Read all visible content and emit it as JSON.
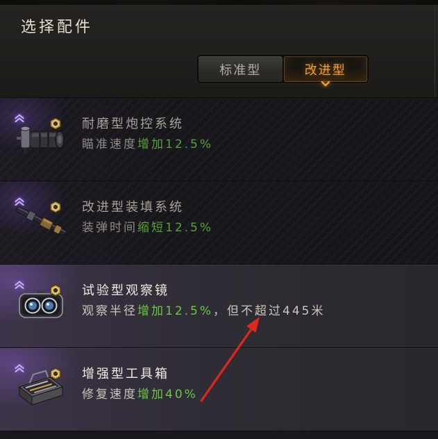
{
  "panel": {
    "title": "选择配件"
  },
  "tabs": [
    {
      "label": "标准型",
      "selected": false
    },
    {
      "label": "改进型",
      "selected": true
    }
  ],
  "equipment_list": [
    {
      "name": "耐磨型炮控系统",
      "stat": "瞄准速度",
      "change": "增加12.5%",
      "icon": "gun-laying-drive-icon",
      "dimmed": true
    },
    {
      "name": "改进型装填系统",
      "stat": "装弹时间",
      "change": "缩短12.5%",
      "icon": "rammer-icon",
      "dimmed": true
    },
    {
      "name": "试验型观察镜",
      "stat": "观察半径",
      "change": "增加12.5%",
      "limit": "，但不超过445米",
      "icon": "optics-icon",
      "dimmed": false
    },
    {
      "name": "增强型工具箱",
      "stat": "修复速度",
      "change": "增加40%",
      "icon": "toolbox-icon",
      "dimmed": false
    }
  ],
  "icons": {
    "upgrade": "upgrade-chevrons-icon",
    "category": "nut-icon",
    "selected_indicator": "chevron-down-icon"
  },
  "colors": {
    "accent": "#f0a02a",
    "positive": "#66cc3a",
    "upgrade": "#c0a8f2",
    "annotation": "#e3261b"
  }
}
